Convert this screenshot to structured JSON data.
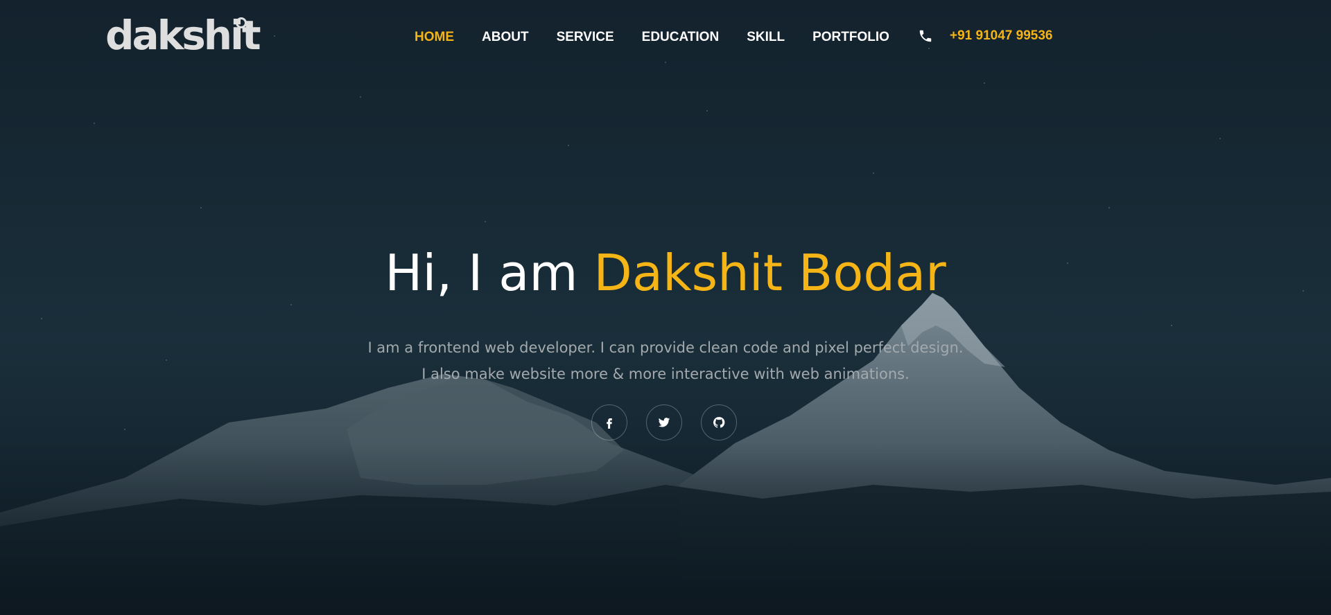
{
  "logo": {
    "text": "dakshit"
  },
  "nav": {
    "items": [
      {
        "label": "HOME",
        "active": true
      },
      {
        "label": "ABOUT",
        "active": false
      },
      {
        "label": "SERVICE",
        "active": false
      },
      {
        "label": "EDUCATION",
        "active": false
      },
      {
        "label": "SKILL",
        "active": false
      },
      {
        "label": "PORTFOLIO",
        "active": false
      }
    ],
    "phone": {
      "icon": "phone-icon",
      "number": "+91 91047 99536"
    }
  },
  "hero": {
    "greeting": "Hi, I am ",
    "name": "Dakshit Bodar",
    "line1": "I am a frontend web developer. I can provide clean code and pixel perfect design.",
    "line2": "I also make website more & more interactive with web animations.",
    "socials": [
      {
        "icon": "facebook-icon"
      },
      {
        "icon": "twitter-icon"
      },
      {
        "icon": "github-icon"
      }
    ]
  },
  "colors": {
    "accent": "#f5b516",
    "text": "#ffffff",
    "muted": "#a3a9ad",
    "background": "#172a35"
  }
}
